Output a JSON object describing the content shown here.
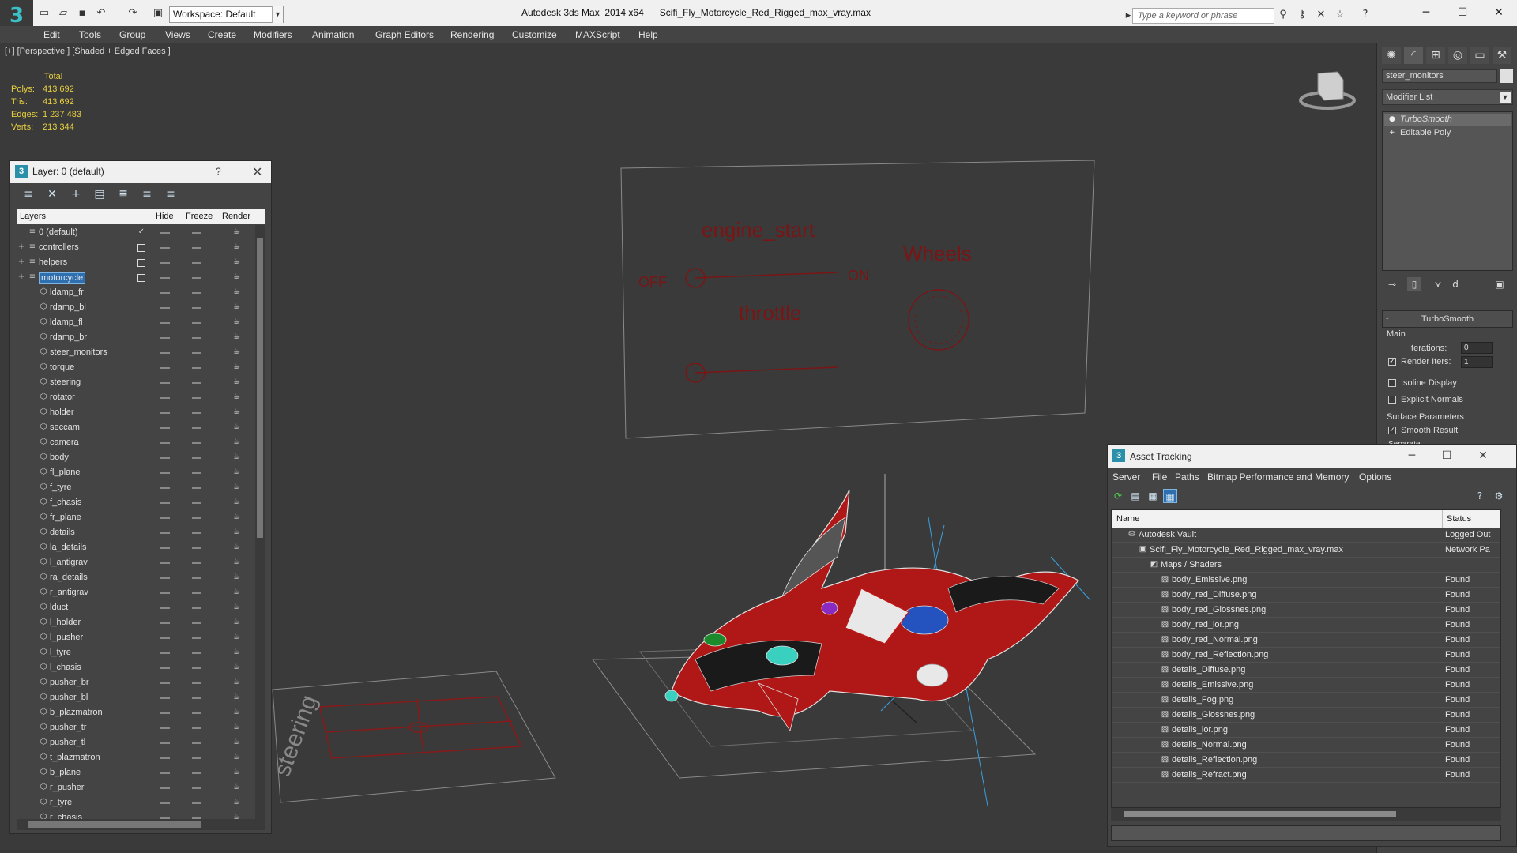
{
  "titlebar": {
    "logo": "3",
    "workspace": "Workspace: Default",
    "title": "Autodesk 3ds Max  2014 x64      Scifi_Fly_Motorcycle_Red_Rigged_max_vray.max",
    "search_placeholder": "Type a keyword or phrase"
  },
  "menu": [
    "Edit",
    "Tools",
    "Group",
    "Views",
    "Create",
    "Modifiers",
    "Animation",
    "Graph Editors",
    "Rendering",
    "Customize",
    "MAXScript",
    "Help"
  ],
  "viewport": {
    "label": "[+] [Perspective ] [Shaded + Edged Faces ]",
    "stats": {
      "header": "Total",
      "polys_label": "Polys:",
      "polys": "413 692",
      "tris_label": "Tris:",
      "tris": "413 692",
      "edges_label": "Edges:",
      "edges": "1 237 483",
      "verts_label": "Verts:",
      "verts": "213 344"
    },
    "panel_texts": {
      "engine_start": "engine_start",
      "off": "OFF",
      "on": "ON",
      "wheels": "Wheels",
      "throttle": "throttle",
      "steering": "steering"
    }
  },
  "layer_panel": {
    "title": "Layer: 0 (default)",
    "help": "?",
    "columns": {
      "layers": "Layers",
      "hide": "Hide",
      "freeze": "Freeze",
      "render": "Render"
    },
    "layers": [
      {
        "name": "0 (default)",
        "level": 0
      },
      {
        "name": "controllers",
        "level": 0
      },
      {
        "name": "helpers",
        "level": 0
      },
      {
        "name": "motorcycle",
        "level": 0
      },
      {
        "name": "ldamp_fr",
        "level": 1
      },
      {
        "name": "rdamp_bl",
        "level": 1
      },
      {
        "name": "ldamp_fl",
        "level": 1
      },
      {
        "name": "rdamp_br",
        "level": 1
      },
      {
        "name": "steer_monitors",
        "level": 1
      },
      {
        "name": "torque",
        "level": 1
      },
      {
        "name": "steering",
        "level": 1
      },
      {
        "name": "rotator",
        "level": 1
      },
      {
        "name": "holder",
        "level": 1
      },
      {
        "name": "seccam",
        "level": 1
      },
      {
        "name": "camera",
        "level": 1
      },
      {
        "name": "body",
        "level": 1
      },
      {
        "name": "fl_plane",
        "level": 1
      },
      {
        "name": "f_tyre",
        "level": 1
      },
      {
        "name": "f_chasis",
        "level": 1
      },
      {
        "name": "fr_plane",
        "level": 1
      },
      {
        "name": "details",
        "level": 1
      },
      {
        "name": "la_details",
        "level": 1
      },
      {
        "name": "l_antigrav",
        "level": 1
      },
      {
        "name": "ra_details",
        "level": 1
      },
      {
        "name": "r_antigrav",
        "level": 1
      },
      {
        "name": "lduct",
        "level": 1
      },
      {
        "name": "l_holder",
        "level": 1
      },
      {
        "name": "l_pusher",
        "level": 1
      },
      {
        "name": "l_tyre",
        "level": 1
      },
      {
        "name": "l_chasis",
        "level": 1
      },
      {
        "name": "pusher_br",
        "level": 1
      },
      {
        "name": "pusher_bl",
        "level": 1
      },
      {
        "name": "b_plazmatron",
        "level": 1
      },
      {
        "name": "pusher_tr",
        "level": 1
      },
      {
        "name": "pusher_tl",
        "level": 1
      },
      {
        "name": "t_plazmatron",
        "level": 1
      },
      {
        "name": "b_plane",
        "level": 1
      },
      {
        "name": "r_pusher",
        "level": 1
      },
      {
        "name": "r_tyre",
        "level": 1
      },
      {
        "name": "r_chasis",
        "level": 1
      }
    ]
  },
  "command_panel": {
    "object_name": "steer_monitors",
    "modifier_list": "Modifier List",
    "stack": [
      "TurboSmooth",
      "Editable Poly"
    ],
    "turbosmooth": {
      "title": "TurboSmooth",
      "main": "Main",
      "iterations_label": "Iterations:",
      "iterations": "0",
      "render_iters_label": "Render Iters:",
      "render_iters": "1",
      "isoline": "Isoline Display",
      "explicit": "Explicit Normals",
      "surface": "Surface Parameters",
      "smooth_result": "Smooth Result",
      "separate": "Separate"
    }
  },
  "asset_tracking": {
    "title": "Asset Tracking",
    "menu": [
      "Server",
      "File",
      "Paths",
      "Bitmap Performance and Memory",
      "Options"
    ],
    "columns": {
      "name": "Name",
      "status": "Status"
    },
    "rows": [
      {
        "name": "Autodesk Vault",
        "level": 0,
        "status": "Logged Out",
        "icon": "vault"
      },
      {
        "name": "Scifi_Fly_Motorcycle_Red_Rigged_max_vray.max",
        "level": 1,
        "status": "Network Pa",
        "icon": "max-file"
      },
      {
        "name": "Maps / Shaders",
        "level": 2,
        "status": "",
        "icon": "maps"
      },
      {
        "name": "body_Emissive.png",
        "level": 3,
        "status": "Found",
        "icon": "image"
      },
      {
        "name": "body_red_Diffuse.png",
        "level": 3,
        "status": "Found",
        "icon": "image"
      },
      {
        "name": "body_red_Glossnes.png",
        "level": 3,
        "status": "Found",
        "icon": "image"
      },
      {
        "name": "body_red_lor.png",
        "level": 3,
        "status": "Found",
        "icon": "image"
      },
      {
        "name": "body_red_Normal.png",
        "level": 3,
        "status": "Found",
        "icon": "image"
      },
      {
        "name": "body_red_Reflection.png",
        "level": 3,
        "status": "Found",
        "icon": "image"
      },
      {
        "name": "details_Diffuse.png",
        "level": 3,
        "status": "Found",
        "icon": "image"
      },
      {
        "name": "details_Emissive.png",
        "level": 3,
        "status": "Found",
        "icon": "image"
      },
      {
        "name": "details_Fog.png",
        "level": 3,
        "status": "Found",
        "icon": "image"
      },
      {
        "name": "details_Glossnes.png",
        "level": 3,
        "status": "Found",
        "icon": "image"
      },
      {
        "name": "details_lor.png",
        "level": 3,
        "status": "Found",
        "icon": "image"
      },
      {
        "name": "details_Normal.png",
        "level": 3,
        "status": "Found",
        "icon": "image"
      },
      {
        "name": "details_Reflection.png",
        "level": 3,
        "status": "Found",
        "icon": "image"
      },
      {
        "name": "details_Refract.png",
        "level": 3,
        "status": "Found",
        "icon": "image"
      }
    ]
  },
  "colors": {
    "stats_text": "#e8d040",
    "wire_red": "#8a1a1a",
    "selection": "#2e6fb0"
  }
}
